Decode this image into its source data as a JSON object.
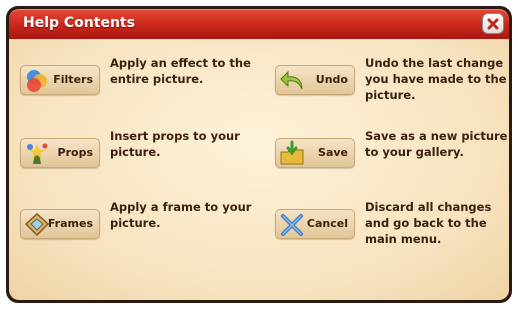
{
  "dialog": {
    "title": "Help Contents",
    "close_icon": "close-icon"
  },
  "items": [
    {
      "button_label": "Filters",
      "icon": "filters-icon",
      "description": "Apply an effect to the entire picture."
    },
    {
      "button_label": "Props",
      "icon": "props-icon",
      "description": "Insert props to your picture."
    },
    {
      "button_label": "Frames",
      "icon": "frames-icon",
      "description": "Apply a frame to your picture."
    },
    {
      "button_label": "Undo",
      "icon": "undo-icon",
      "description": "Undo the last change you have made to the picture."
    },
    {
      "button_label": "Save",
      "icon": "save-icon",
      "description": "Save as a new picture to your gallery."
    },
    {
      "button_label": "Cancel",
      "icon": "cancel-icon",
      "description": "Discard all changes and go back to the main menu."
    }
  ],
  "colors": {
    "title_bar": "#c9261a",
    "panel": "#f7e3bf",
    "text": "#3b1f0f",
    "button": "#ecd3a8"
  }
}
